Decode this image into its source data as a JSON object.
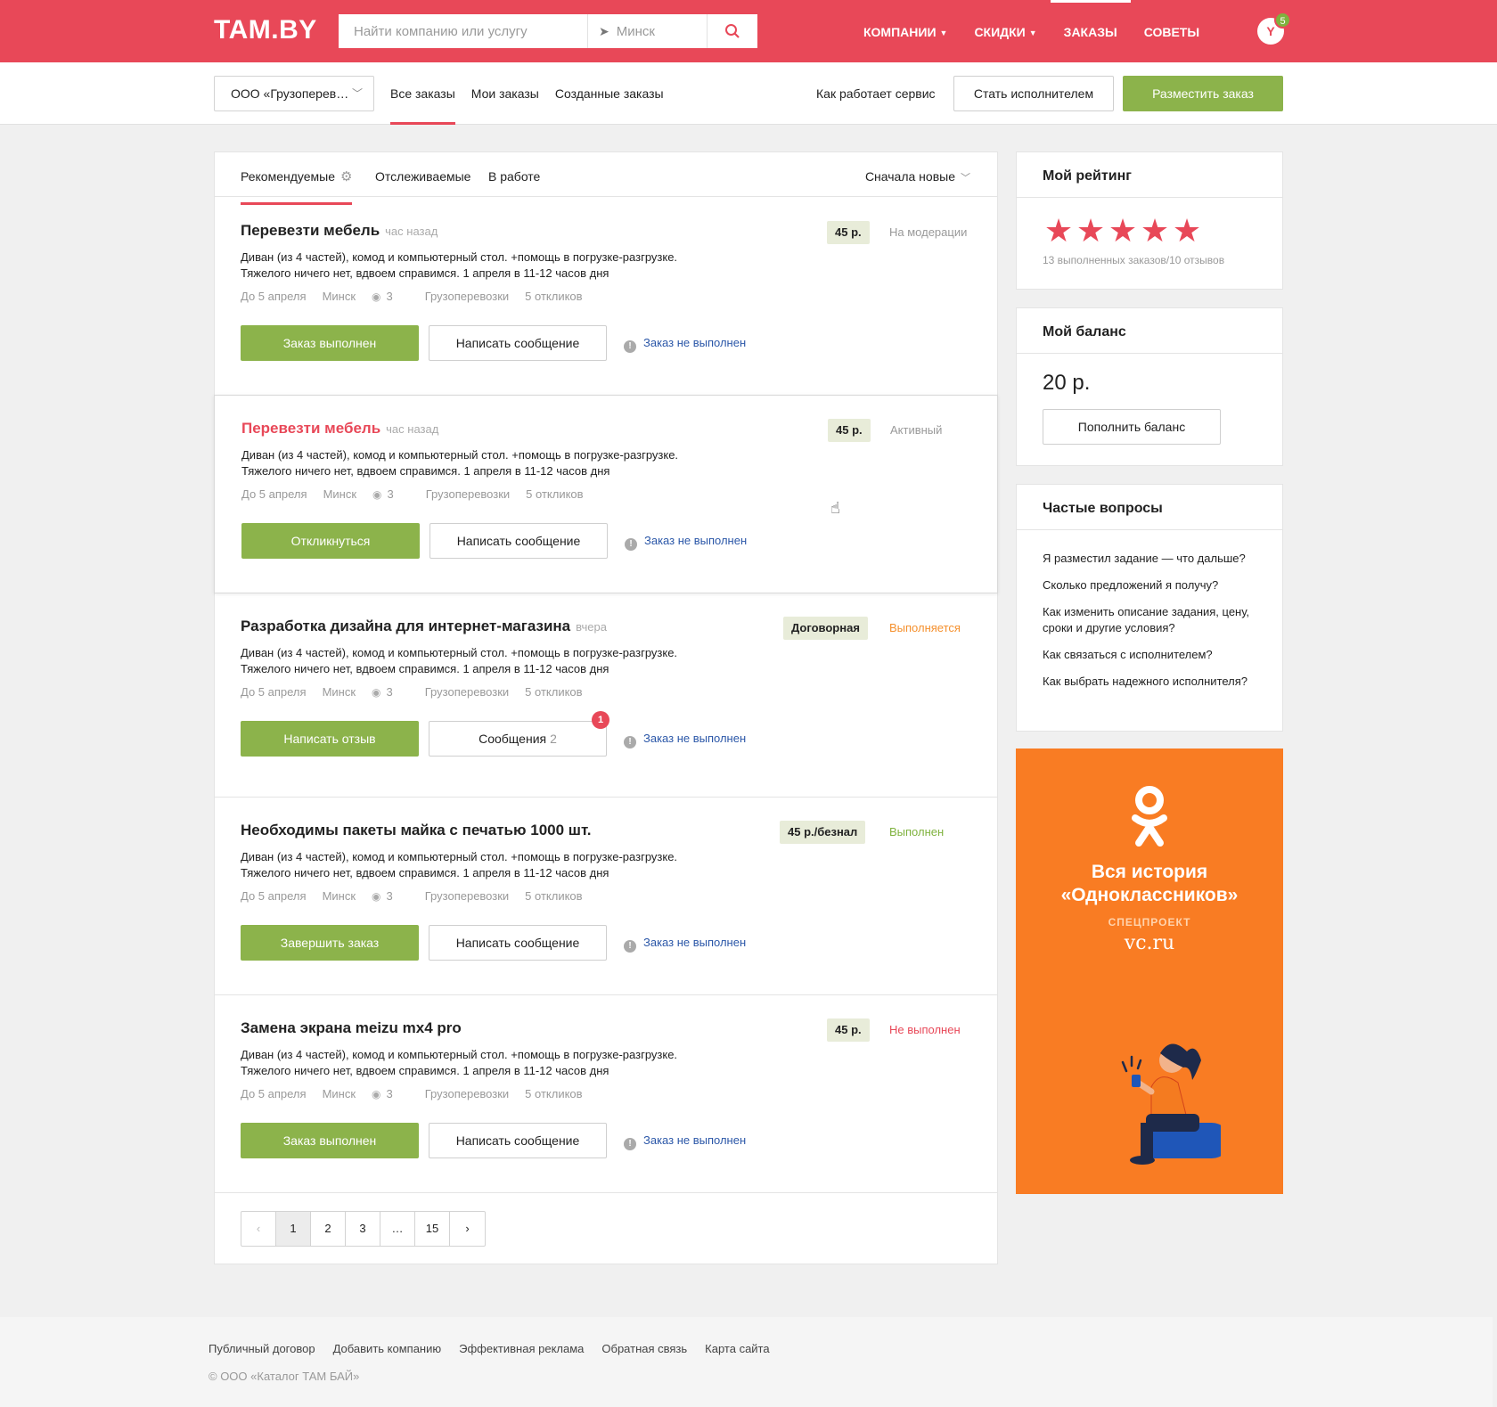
{
  "header": {
    "logo": "TAM.BY",
    "search_placeholder": "Найти компанию или услугу",
    "city": "Минск",
    "nav": [
      {
        "label": "КОМПАНИИ",
        "caret": true
      },
      {
        "label": "СКИДКИ",
        "caret": true
      },
      {
        "label": "ЗАКАЗЫ",
        "caret": false,
        "active": true
      },
      {
        "label": "СОВЕТЫ",
        "caret": false
      }
    ],
    "avatar_letter": "Y",
    "notifications": "5"
  },
  "subheader": {
    "company": "ООО «Грузоперев…",
    "tabs": [
      "Все заказы",
      "Мои заказы",
      "Созданные заказы"
    ],
    "how_it_works": "Как работает сервис",
    "become_executor": "Стать исполнителем",
    "place_order": "Разместить заказ"
  },
  "filters": {
    "tabs": [
      "Рекомендуемые",
      "Отслеживаемые",
      "В работе"
    ],
    "sort": "Сначала новые"
  },
  "orders": [
    {
      "title": "Перевезти мебель",
      "time": "час назад",
      "price": "45 р.",
      "status": "На модерации",
      "desc1": "Диван (из 4 частей), комод и компьютерный стол. +помощь в погрузке-разгрузке.",
      "desc2": "Тяжелого ничего нет, вдвоем справимся. 1 апреля в 11-12 часов дня",
      "deadline": "До 5 апреля",
      "city": "Минск",
      "views": "3",
      "category": "Грузоперевозки",
      "responses": "5 откликов",
      "primary_action": "Заказ выполнен",
      "secondary_action": "Написать сообщение",
      "fail_link": "Заказ не выполнен"
    },
    {
      "title": "Перевезти мебель",
      "time": "час назад",
      "price": "45 р.",
      "status": "Активный",
      "desc1": "Диван (из 4 частей), комод и компьютерный стол. +помощь в погрузке-разгрузке.",
      "desc2": "Тяжелого ничего нет, вдвоем справимся. 1 апреля в 11-12 часов дня",
      "deadline": "До 5 апреля",
      "city": "Минск",
      "views": "3",
      "category": "Грузоперевозки",
      "responses": "5 откликов",
      "primary_action": "Откликнуться",
      "secondary_action": "Написать сообщение",
      "fail_link": "Заказ не выполнен"
    },
    {
      "title": "Разработка дизайна для интернет-магазина",
      "time": "вчера",
      "price": "Договорная",
      "status": "Выполняется",
      "desc1": "Диван (из 4 частей), комод и компьютерный стол. +помощь в погрузке-разгрузке.",
      "desc2": "Тяжелого ничего нет, вдвоем справимся. 1 апреля в 11-12 часов дня",
      "deadline": "До 5 апреля",
      "city": "Минск",
      "views": "3",
      "category": "Грузоперевозки",
      "responses": "5 откликов",
      "primary_action": "Написать отзыв",
      "secondary_action": "Сообщения",
      "messages_count": "2",
      "unread": "1",
      "fail_link": "Заказ не выполнен"
    },
    {
      "title": "Необходимы пакеты майка с печатью 1000 шт.",
      "time": "",
      "price": "45 р./безнал",
      "status": "Выполнен",
      "desc1": "Диван (из 4 частей), комод и компьютерный стол. +помощь в погрузке-разгрузке.",
      "desc2": "Тяжелого ничего нет, вдвоем справимся. 1 апреля в 11-12 часов дня",
      "deadline": "До 5 апреля",
      "city": "Минск",
      "views": "3",
      "category": "Грузоперевозки",
      "responses": "5 откликов",
      "primary_action": "Завершить заказ",
      "secondary_action": "Написать сообщение",
      "fail_link": "Заказ не выполнен"
    },
    {
      "title": "Замена экрана meizu mx4 pro",
      "time": "",
      "price": "45 р.",
      "status": "Не выполнен",
      "desc1": "Диван (из 4 частей), комод и компьютерный стол. +помощь в погрузке-разгрузке.",
      "desc2": "Тяжелого ничего нет, вдвоем справимся. 1 апреля в 11-12 часов дня",
      "deadline": "До 5 апреля",
      "city": "Минск",
      "views": "3",
      "category": "Грузоперевозки",
      "responses": "5 откликов",
      "primary_action": "Заказ выполнен",
      "secondary_action": "Написать сообщение",
      "fail_link": "Заказ не выполнен"
    }
  ],
  "pagination": {
    "pages": [
      "1",
      "2",
      "3",
      "…",
      "15"
    ],
    "current": "1"
  },
  "rating": {
    "title": "Мой рейтинг",
    "stars": 5,
    "text": "13 выполненных заказов/10 отзывов"
  },
  "balance": {
    "title": "Мой баланс",
    "amount": "20 р.",
    "topup": "Пополнить баланс"
  },
  "faq": {
    "title": "Частые вопросы",
    "items": [
      "Я разместил задание — что дальше?",
      "Сколько предложений я получу?",
      "Как изменить описание задания, цену, сроки и другие условия?",
      "Как связаться с исполнителем?",
      "Как выбрать надежного исполнителя?"
    ]
  },
  "ad": {
    "title1": "Вся история",
    "title2": "«Одноклассников»",
    "sub": "СПЕЦПРОЕКТ",
    "site": "vc.ru"
  },
  "footer": {
    "links": [
      "Публичный договор",
      "Добавить компанию",
      "Эффективная реклама",
      "Обратная связь",
      "Карта сайта"
    ],
    "copyright": "© ООО «Каталог ТАМ БАЙ»"
  },
  "colors": {
    "brand": "#e84858",
    "accent_green": "#8cb34b",
    "status_orange": "#f5902d",
    "status_green": "#7fb23e",
    "ad_bg": "#f97c23"
  }
}
